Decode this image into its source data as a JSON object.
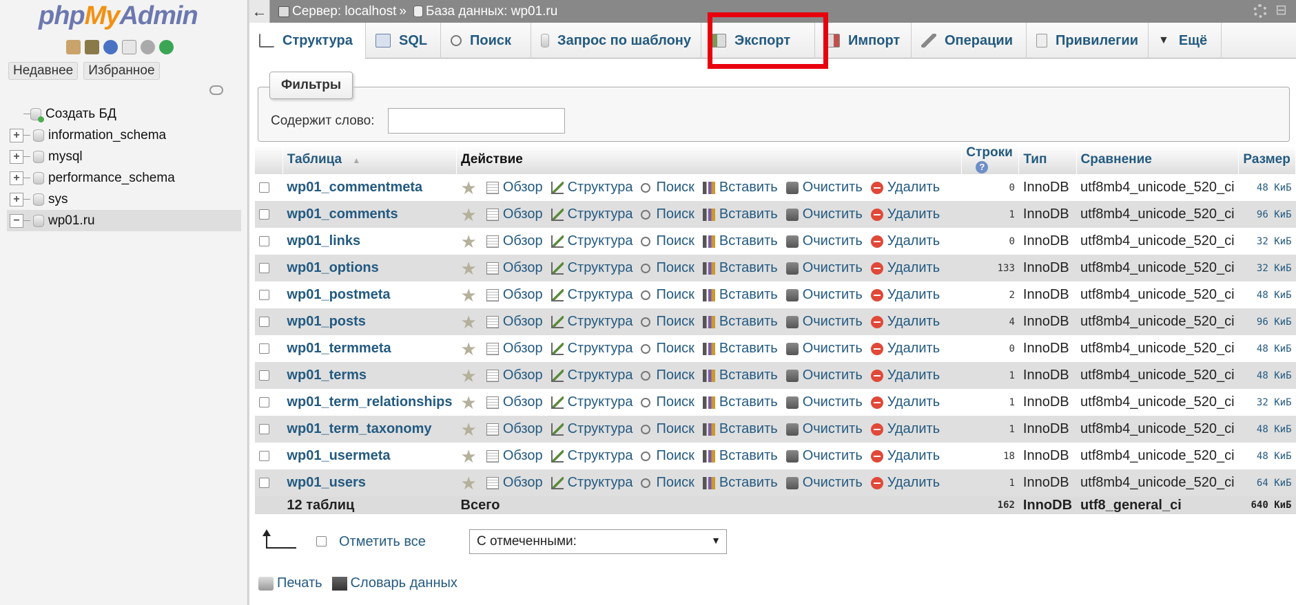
{
  "sidebar": {
    "logo": {
      "php": "php",
      "my": "My",
      "admin": "Admin"
    },
    "quick_icons": [
      "home-icon",
      "exit-icon",
      "help-icon",
      "docs-icon",
      "settings-icon",
      "reload-icon"
    ],
    "recent_label": "Недавнее",
    "favorites_label": "Избранное",
    "tree": [
      {
        "label": "Создать БД",
        "type": "new"
      },
      {
        "label": "information_schema",
        "type": "db"
      },
      {
        "label": "mysql",
        "type": "db"
      },
      {
        "label": "performance_schema",
        "type": "db"
      },
      {
        "label": "sys",
        "type": "db"
      },
      {
        "label": "wp01.ru",
        "type": "db",
        "active": true
      }
    ]
  },
  "topbar": {
    "server_label": "Сервер: localhost",
    "separator": "»",
    "db_label": "База данных: wp01.ru"
  },
  "tabs": [
    {
      "label": "Структура",
      "active": true
    },
    {
      "label": "SQL"
    },
    {
      "label": "Поиск"
    },
    {
      "label": "Запрос по шаблону"
    },
    {
      "label": "Экспорт",
      "highlighted": true
    },
    {
      "label": "Импорт"
    },
    {
      "label": "Операции"
    },
    {
      "label": "Привилегии"
    },
    {
      "label": "Ещё"
    }
  ],
  "filters": {
    "legend": "Фильтры",
    "contains_label": "Содержит слово:",
    "value": ""
  },
  "table": {
    "headers": {
      "table": "Таблица",
      "action": "Действие",
      "rows": "Строки",
      "type": "Тип",
      "collation": "Сравнение",
      "size": "Размер"
    },
    "actions": [
      "Обзор",
      "Структура",
      "Поиск",
      "Вставить",
      "Очистить",
      "Удалить"
    ],
    "rows": [
      {
        "name": "wp01_commentmeta",
        "rows": "0",
        "type": "InnoDB",
        "collation": "utf8mb4_unicode_520_ci",
        "size": "48 КиБ"
      },
      {
        "name": "wp01_comments",
        "rows": "1",
        "type": "InnoDB",
        "collation": "utf8mb4_unicode_520_ci",
        "size": "96 КиБ"
      },
      {
        "name": "wp01_links",
        "rows": "0",
        "type": "InnoDB",
        "collation": "utf8mb4_unicode_520_ci",
        "size": "32 КиБ"
      },
      {
        "name": "wp01_options",
        "rows": "133",
        "type": "InnoDB",
        "collation": "utf8mb4_unicode_520_ci",
        "size": "32 КиБ"
      },
      {
        "name": "wp01_postmeta",
        "rows": "2",
        "type": "InnoDB",
        "collation": "utf8mb4_unicode_520_ci",
        "size": "48 КиБ"
      },
      {
        "name": "wp01_posts",
        "rows": "4",
        "type": "InnoDB",
        "collation": "utf8mb4_unicode_520_ci",
        "size": "96 КиБ"
      },
      {
        "name": "wp01_termmeta",
        "rows": "0",
        "type": "InnoDB",
        "collation": "utf8mb4_unicode_520_ci",
        "size": "48 КиБ"
      },
      {
        "name": "wp01_terms",
        "rows": "1",
        "type": "InnoDB",
        "collation": "utf8mb4_unicode_520_ci",
        "size": "48 КиБ"
      },
      {
        "name": "wp01_term_relationships",
        "rows": "1",
        "type": "InnoDB",
        "collation": "utf8mb4_unicode_520_ci",
        "size": "32 КиБ"
      },
      {
        "name": "wp01_term_taxonomy",
        "rows": "1",
        "type": "InnoDB",
        "collation": "utf8mb4_unicode_520_ci",
        "size": "48 КиБ"
      },
      {
        "name": "wp01_usermeta",
        "rows": "18",
        "type": "InnoDB",
        "collation": "utf8mb4_unicode_520_ci",
        "size": "48 КиБ"
      },
      {
        "name": "wp01_users",
        "rows": "1",
        "type": "InnoDB",
        "collation": "utf8mb4_unicode_520_ci",
        "size": "64 КиБ"
      }
    ],
    "footer": {
      "count": "12 таблиц",
      "total_label": "Всего",
      "rows": "162",
      "type": "InnoDB",
      "collation": "utf8_general_ci",
      "size": "640 КиБ"
    }
  },
  "bottom": {
    "check_all": "Отметить все",
    "with_selected": "С отмеченными:",
    "print": "Печать",
    "data_dictionary": "Словарь данных"
  },
  "colors": {
    "link": "#235a81",
    "highlight": "#e8000d",
    "topbar": "#888888"
  }
}
